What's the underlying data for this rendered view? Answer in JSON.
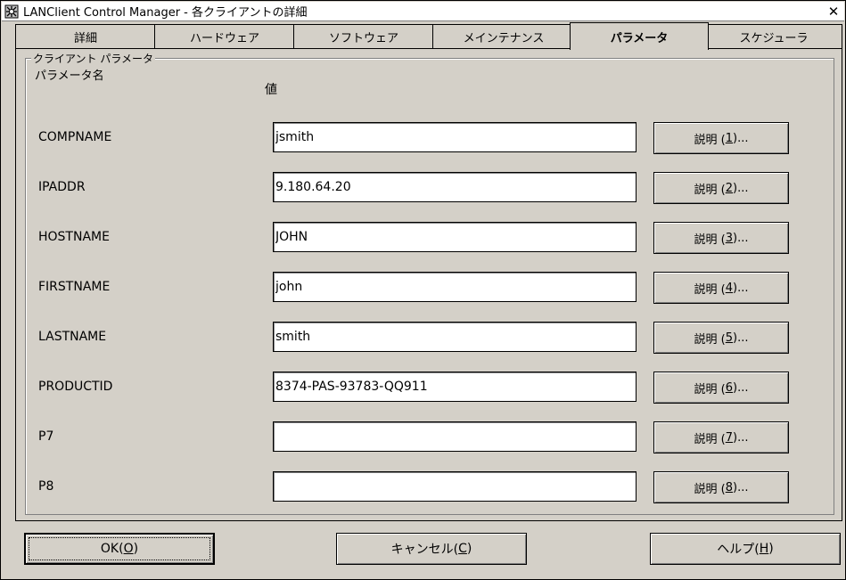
{
  "window": {
    "title": "LANClient Control Manager - 各クライアントの詳細",
    "close_glyph": "✕",
    "app_icon": "network-clients-icon"
  },
  "tabs": [
    {
      "label": "詳細"
    },
    {
      "label": "ハードウェア"
    },
    {
      "label": "ソフトウェア"
    },
    {
      "label": "メインテナンス"
    },
    {
      "label": "パラメータ",
      "selected": true
    },
    {
      "label": "スケジューラ"
    }
  ],
  "group": {
    "title": "クライアント パラメータ",
    "col_name": "パラメータ名",
    "col_value": "値"
  },
  "params": [
    {
      "name": "COMPNAME",
      "value": "jsmith",
      "btn_text": "説明 (",
      "btn_key": "1",
      "btn_tail": ")..."
    },
    {
      "name": "IPADDR",
      "value": "9.180.64.20",
      "btn_text": "説明 (",
      "btn_key": "2",
      "btn_tail": ")..."
    },
    {
      "name": "HOSTNAME",
      "value": "JOHN",
      "btn_text": "説明 (",
      "btn_key": "3",
      "btn_tail": ")..."
    },
    {
      "name": "FIRSTNAME",
      "value": "john",
      "btn_text": "説明 (",
      "btn_key": "4",
      "btn_tail": ")..."
    },
    {
      "name": "LASTNAME",
      "value": "smith",
      "btn_text": "説明 (",
      "btn_key": "5",
      "btn_tail": ")..."
    },
    {
      "name": "PRODUCTID",
      "value": "8374-PAS-93783-QQ911",
      "btn_text": "説明 (",
      "btn_key": "6",
      "btn_tail": ")..."
    },
    {
      "name": "P7",
      "value": "",
      "btn_text": "説明 (",
      "btn_key": "7",
      "btn_tail": ")..."
    },
    {
      "name": "P8",
      "value": "",
      "btn_text": "説明 (",
      "btn_key": "8",
      "btn_tail": ")..."
    }
  ],
  "buttons": {
    "ok_text": "OK(",
    "ok_key": "O",
    "ok_tail": ")",
    "cancel_text": "キャンセル(",
    "cancel_key": "C",
    "cancel_tail": ")",
    "help_text": "ヘルプ(",
    "help_key": "H",
    "help_tail": ")"
  }
}
